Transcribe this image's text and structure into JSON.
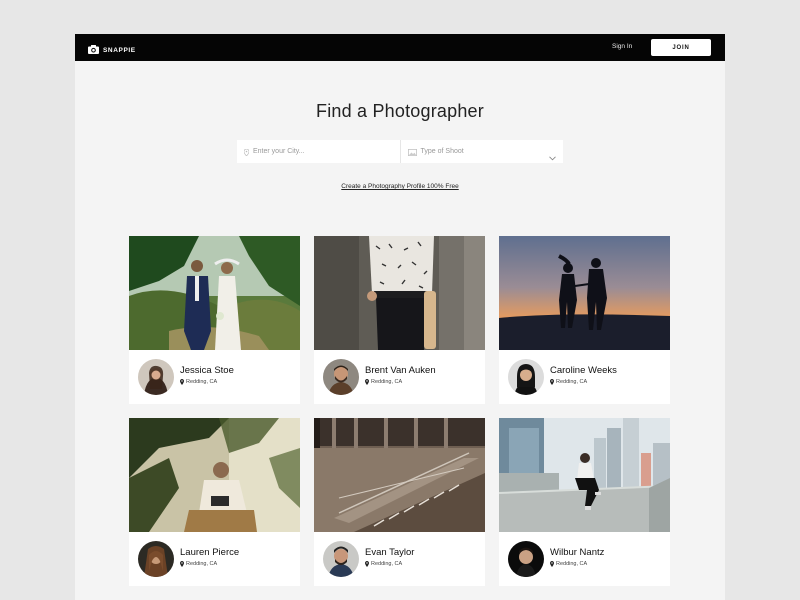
{
  "nav": {
    "brand": "SNAPPIE",
    "sign_in": "Sign In",
    "join": "JOIN"
  },
  "hero": {
    "title": "Find a Photographer"
  },
  "search": {
    "city_placeholder": "Enter your City...",
    "shoot_type_placeholder": "Type of Shoot"
  },
  "create_profile_link": "Create a Photography Profile 100% Free",
  "photographers": [
    {
      "name": "Jessica Stoe",
      "location": "Redding, CA"
    },
    {
      "name": "Brent Van Auken",
      "location": "Redding, CA"
    },
    {
      "name": "Caroline Weeks",
      "location": "Redding, CA"
    },
    {
      "name": "Lauren Pierce",
      "location": "Redding, CA"
    },
    {
      "name": "Evan Taylor",
      "location": "Redding, CA"
    },
    {
      "name": "Wilbur Nantz",
      "location": "Redding, CA"
    }
  ],
  "colors": {
    "page_bg": "#e7e7e7",
    "content_bg": "#f4f4f4",
    "navbar_bg": "#050505"
  }
}
